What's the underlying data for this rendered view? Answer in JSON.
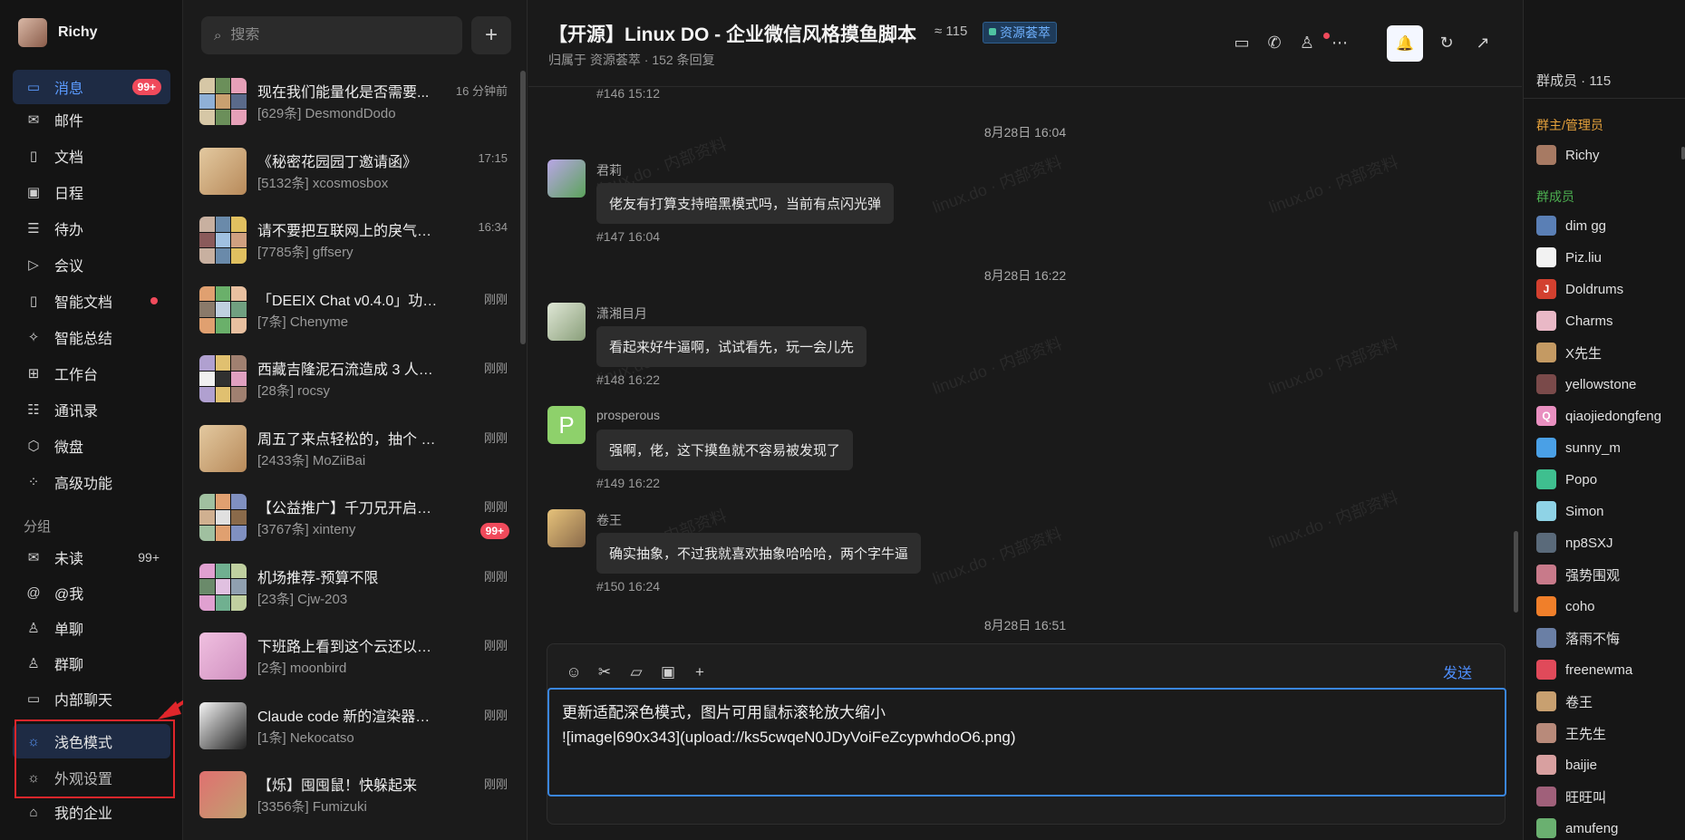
{
  "user": {
    "name": "Richy"
  },
  "nav": {
    "items": [
      {
        "label": "消息",
        "icon": "chat-icon",
        "badge": "99+",
        "active": true
      },
      {
        "label": "邮件",
        "icon": "mail-icon"
      },
      {
        "label": "文档",
        "icon": "doc-icon"
      },
      {
        "label": "日程",
        "icon": "calendar-icon"
      },
      {
        "label": "待办",
        "icon": "todo-icon"
      },
      {
        "label": "会议",
        "icon": "video-icon"
      },
      {
        "label": "智能文档",
        "icon": "smart-doc-icon",
        "dot": true
      },
      {
        "label": "智能总结",
        "icon": "sparkle-icon"
      },
      {
        "label": "工作台",
        "icon": "grid-icon"
      },
      {
        "label": "通讯录",
        "icon": "contacts-icon"
      },
      {
        "label": "微盘",
        "icon": "cube-icon"
      },
      {
        "label": "高级功能",
        "icon": "dots-icon"
      }
    ],
    "group_label": "分组",
    "groups": [
      {
        "label": "未读",
        "icon": "mail-icon",
        "count": "99+"
      },
      {
        "label": "@我",
        "icon": "at-icon"
      },
      {
        "label": "单聊",
        "icon": "person-icon"
      },
      {
        "label": "群聊",
        "icon": "group-icon"
      },
      {
        "label": "内部聊天",
        "icon": "chat-icon"
      }
    ],
    "bottom": [
      {
        "label": "浅色模式",
        "icon": "sun-icon",
        "active": true
      },
      {
        "label": "外观设置",
        "icon": "sun-icon"
      },
      {
        "label": "我的企业",
        "icon": "home-icon"
      }
    ]
  },
  "search": {
    "placeholder": "搜索",
    "add": "+"
  },
  "conversations": [
    {
      "title": "现在我们能量化是否需要...",
      "sub": "[629条] DesmondDodo",
      "time": "16 分钟前"
    },
    {
      "title": "《秘密花园园丁邀请函》",
      "sub": "[5132条] xcosmosbox",
      "time": "17:15"
    },
    {
      "title": "请不要把互联网上的戾气带来...",
      "sub": "[7785条] gffsery",
      "time": "16:34"
    },
    {
      "title": "「DEEIX Chat v0.4.0」功能、...",
      "sub": "[7条] Chenyme",
      "time": "刚刚"
    },
    {
      "title": "西藏吉隆泥石流造成 3 人遇难...",
      "sub": "[28条] rocsy",
      "time": "刚刚"
    },
    {
      "title": "周五了来点轻松的，抽个 Pre...",
      "sub": "[2433条] MoZiiBai",
      "time": "刚刚"
    },
    {
      "title": "【公益推广】千刀兄开启美好8...",
      "sub": "[3767条] xinteny",
      "time": "刚刚",
      "badge": "99+"
    },
    {
      "title": "机场推荐-预算不限",
      "sub": "[23条] Cjw-203",
      "time": "刚刚"
    },
    {
      "title": "下班路上看到这个云还以为二...",
      "sub": "[2条] moonbird",
      "time": "刚刚"
    },
    {
      "title": "Claude code 新的渲染器感觉...",
      "sub": "[1条] Nekocatso",
      "time": "刚刚"
    },
    {
      "title": "【烁】囤囤鼠！快躲起来",
      "sub": "[3356条] Fumizuki",
      "time": "刚刚"
    }
  ],
  "chat": {
    "title": "【开源】Linux DO - 企业微信风格摸鱼脚本",
    "member_count": "≈ 115",
    "tag": "资源荟萃",
    "subtitle": "归属于 资源荟萃 · 152 条回复",
    "watermark": "linux.do · 内部资料",
    "top_meta": "#146  15:12",
    "date1": "8月28日 16:04",
    "date2": "8月28日 16:22",
    "date3": "8月28日 16:51",
    "messages": [
      {
        "name": "君莉",
        "text": "佬友有打算支持暗黑模式吗，当前有点闪光弹",
        "meta": "#147  16:04"
      },
      {
        "name": "潇湘目月",
        "text": "看起来好牛逼啊，试试看先，玩一会儿先",
        "meta": "#148  16:22"
      },
      {
        "name": "prosperous",
        "text": "强啊，佬，这下摸鱼就不容易被发现了",
        "meta": "#149  16:22",
        "initial": "P"
      },
      {
        "name": "卷王",
        "text": "确实抽象，不过我就喜欢抽象哈哈哈，两个字牛逼",
        "meta": "#150  16:24"
      }
    ],
    "send": "发送",
    "draft_line1": "更新适配深色模式，图片可用鼠标滚轮放大缩小",
    "draft_line2": "![image|690x343](upload://ks5cwqeN0JDyVoiFeZcypwhdoO6.png)"
  },
  "members": {
    "header": "群成员 · 115",
    "admin_label": "群主/管理员",
    "member_label": "群成员",
    "admins": [
      {
        "name": "Richy",
        "color": "#a77a63"
      }
    ],
    "list": [
      {
        "name": "dim gg",
        "color": "#5a7fb5"
      },
      {
        "name": "Piz.liu",
        "color": "#f2f2f2"
      },
      {
        "name": "Doldrums",
        "color": "#d2402f",
        "initial": "J"
      },
      {
        "name": "Charms",
        "color": "#e9b8c6"
      },
      {
        "name": "X先生",
        "color": "#c49a63"
      },
      {
        "name": "yellowstone",
        "color": "#7a4a4a"
      },
      {
        "name": "qiaojiedongfeng",
        "color": "#e98fc0",
        "initial": "Q"
      },
      {
        "name": "sunny_m",
        "color": "#4aa0e6"
      },
      {
        "name": "Popo",
        "color": "#3fbf8f"
      },
      {
        "name": "Simon",
        "color": "#8fd3e6"
      },
      {
        "name": "np8SXJ",
        "color": "#5a6a7a"
      },
      {
        "name": "强势围观",
        "color": "#c87a8a"
      },
      {
        "name": "coho",
        "color": "#f07f2a"
      },
      {
        "name": "落雨不悔",
        "color": "#6a7fa5"
      },
      {
        "name": "freenewma",
        "color": "#e04a5a"
      },
      {
        "name": "卷王",
        "color": "#c8a070"
      },
      {
        "name": "王先生",
        "color": "#b88a7a"
      },
      {
        "name": "baijie",
        "color": "#d8a0a0"
      },
      {
        "name": "旺旺叫",
        "color": "#a0607a"
      },
      {
        "name": "amufeng",
        "color": "#6ab070"
      }
    ]
  },
  "colors": {
    "accent": "#5b9bff",
    "badge": "#f04a5b",
    "admin_label": "#e6a23c",
    "member_label": "#4caf50",
    "highlight_box": "#e0262b"
  }
}
